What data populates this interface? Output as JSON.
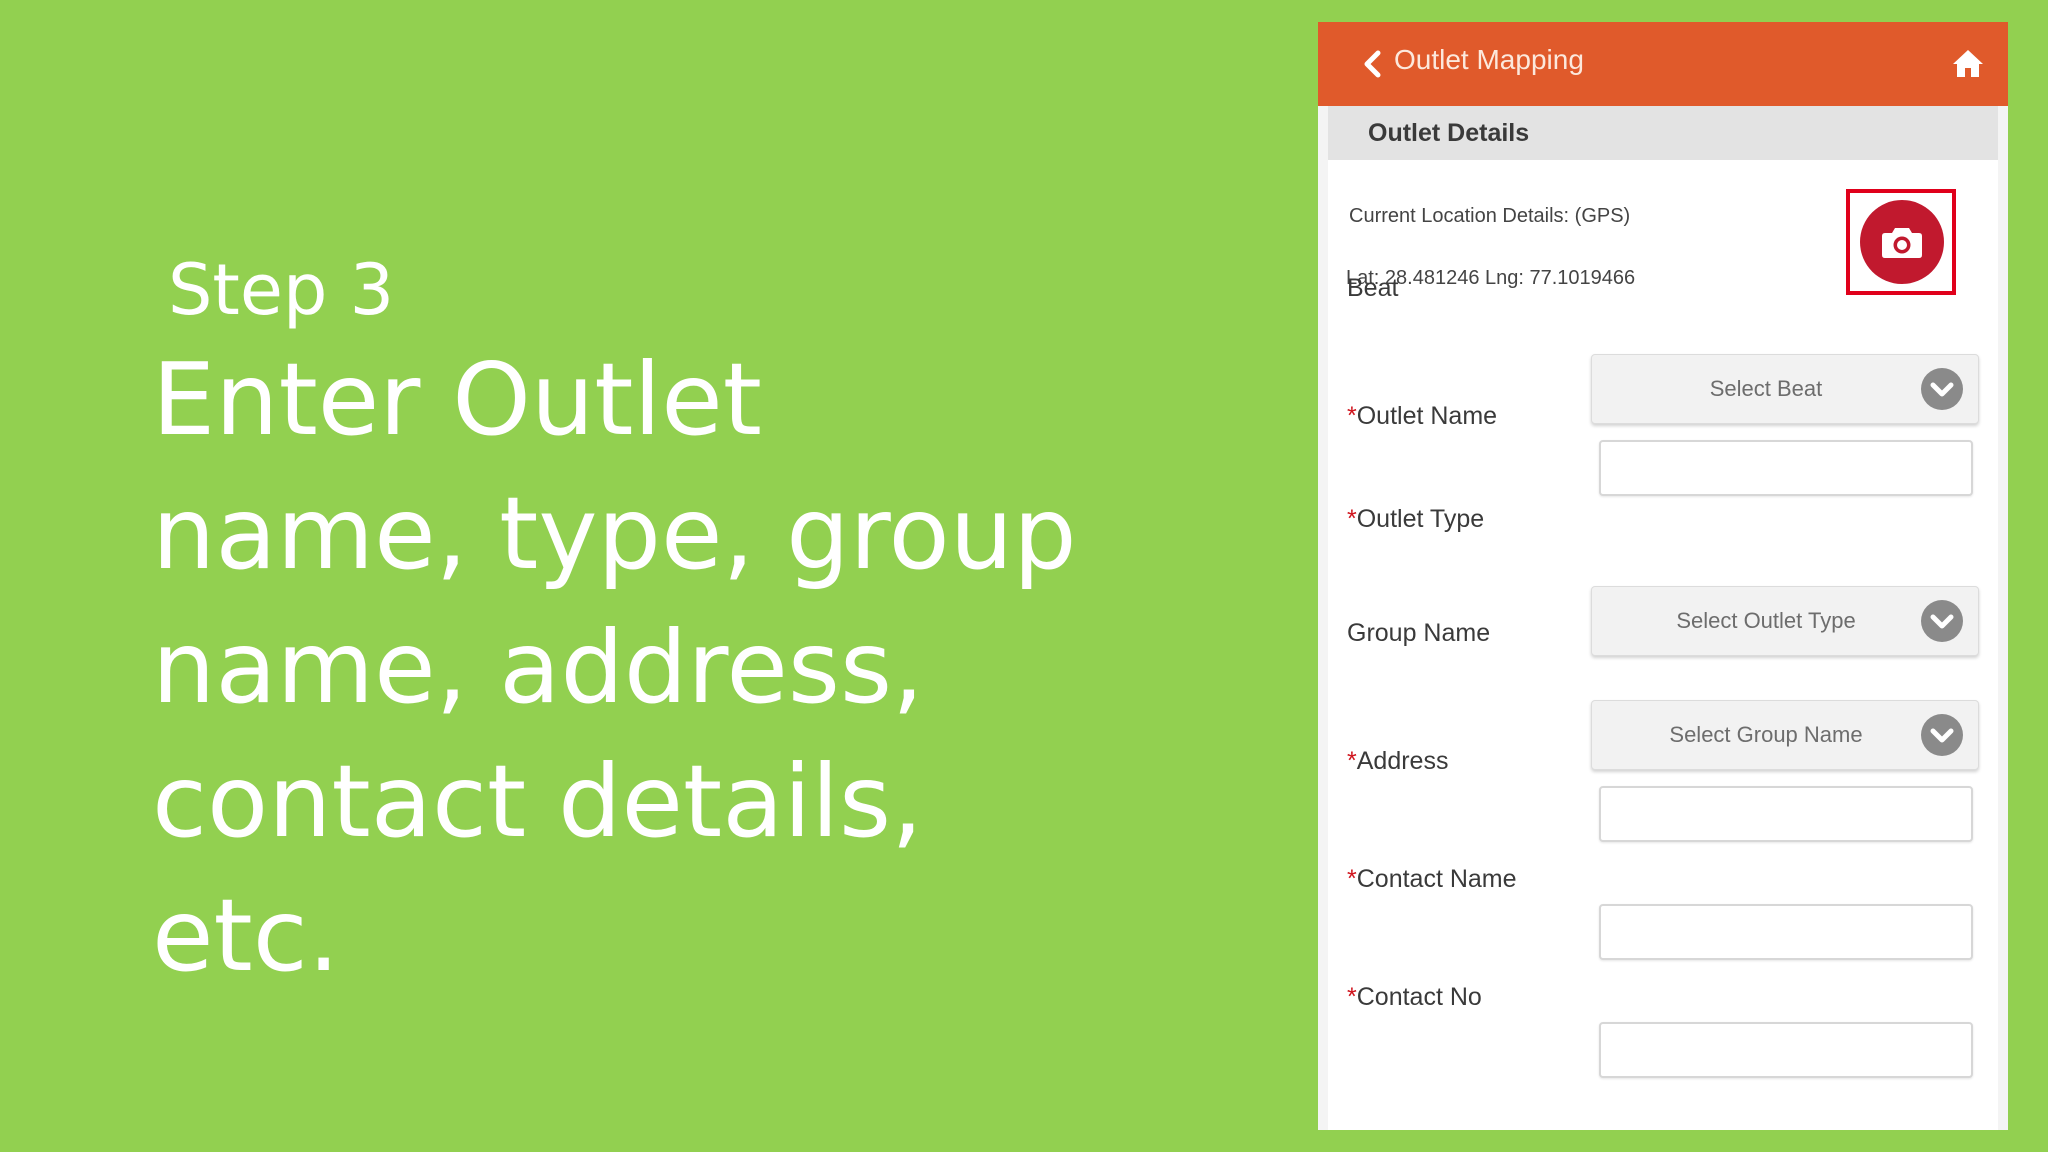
{
  "slide": {
    "step_label": "Step 3",
    "instruction_lines": [
      "Enter Outlet",
      "name, type, group",
      "name, address,",
      "contact details,",
      "etc."
    ]
  },
  "app": {
    "title": "Outlet Mapping",
    "back_icon": "chevron-left-icon",
    "home_icon": "home-icon",
    "accent_color": "#e05a2b"
  },
  "form": {
    "section_title": "Outlet Details",
    "location_label": "Current Location Details:  (GPS)",
    "coordinates_text": "Lat: 28.481246 Lng: 77.1019466",
    "camera_icon": "camera-icon",
    "required_marker": "*",
    "fields": {
      "beat": {
        "label": "Beat",
        "placeholder": "Select Beat"
      },
      "outlet_name": {
        "label": "Outlet Name",
        "value": ""
      },
      "outlet_type": {
        "label": "Outlet Type",
        "placeholder": "Select Outlet Type"
      },
      "group_name": {
        "label": "Group Name",
        "placeholder": "Select Group Name"
      },
      "address": {
        "label": "Address",
        "value": ""
      },
      "contact_name": {
        "label": "Contact Name",
        "value": ""
      },
      "contact_no": {
        "label": "Contact No",
        "value": ""
      }
    }
  }
}
